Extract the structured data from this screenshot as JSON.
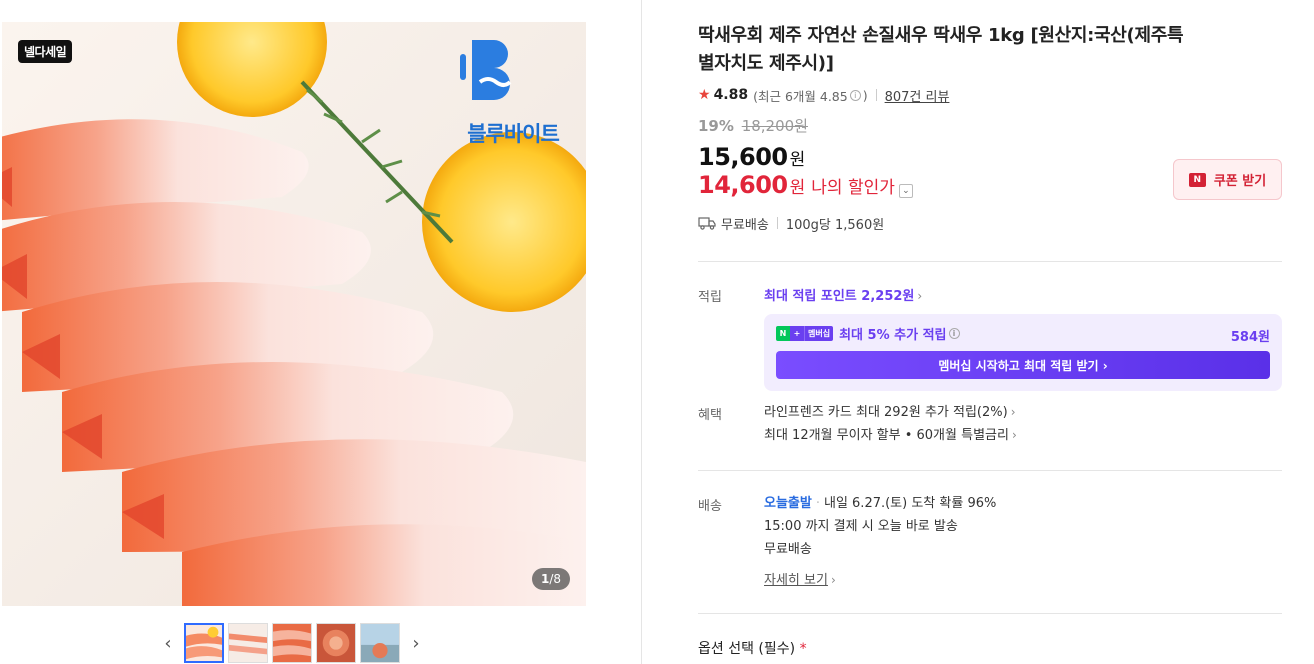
{
  "gallery": {
    "sale_badge": "넬다세일",
    "brand_name": "블루바이트",
    "counter_current": "1",
    "counter_total": "/8",
    "prev_label": "‹",
    "next_label": "›"
  },
  "product": {
    "title": "딱새우회 제주 자연산 손질새우 딱새우 1kg [원산지:국산(제주특별자치도 제주시)]",
    "rating": "4.88",
    "rating_recent": "(최근 6개월 4.85",
    "rating_close": ")",
    "review_count": "807건 리뷰",
    "discount": "19%",
    "old_price": "18,200원",
    "price": "15,600",
    "price_unit": "원",
    "my_price": "14,600",
    "my_price_unit": "원",
    "my_price_label": "나의 할인가",
    "coupon_label": "쿠폰 받기",
    "shipping": "무료배송",
    "unit_price": "100g당 1,560원"
  },
  "points": {
    "label": "적립",
    "max_link": "최대 적립 포인트 2,252원",
    "extra_label": "최대 5% 추가 적립",
    "badge_n": "N",
    "badge_plus": "+",
    "badge_member": "멤버십",
    "extra_amount": "584원",
    "member_button": "멤버십 시작하고 최대 적립 받기 ›"
  },
  "benefits": {
    "label": "혜택",
    "line1": "라인프렌즈 카드 최대 292원 추가 적립(2%)",
    "line2": "최대 12개월 무이자 할부 • 60개월 특별금리"
  },
  "delivery": {
    "label": "배송",
    "today": "오늘출발",
    "arrival": "내일 6.27.(토) 도착 확률 96%",
    "cutoff": "15:00 까지 결제 시 오늘 바로 발송",
    "fee": "무료배송",
    "detail_link": "자세히 보기"
  },
  "options": {
    "title": "옵션 선택 (필수)",
    "required_mark": "*"
  },
  "colors": {
    "accent_red": "#e1253a",
    "point_purple": "#6a3ff0",
    "today_blue": "#2a6ce0"
  }
}
